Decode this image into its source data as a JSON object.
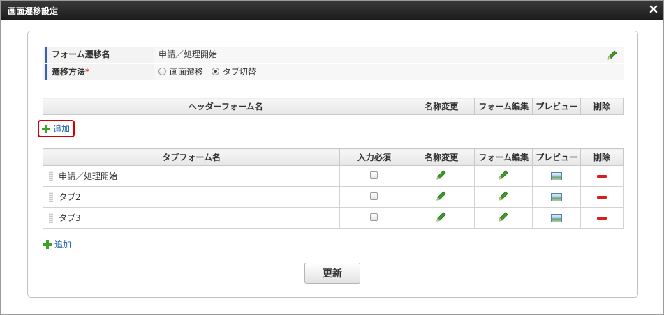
{
  "dialog": {
    "title": "画面遷移設定"
  },
  "form_name": {
    "label": "フォーム遷移名",
    "value": "申請／処理開始"
  },
  "transition_method": {
    "label": "遷移方法",
    "required_mark": "*",
    "options": [
      {
        "label": "画面遷移",
        "selected": false
      },
      {
        "label": "タブ切替",
        "selected": true
      }
    ]
  },
  "header_table": {
    "columns": [
      "ヘッダーフォーム名",
      "名称変更",
      "フォーム編集",
      "プレビュー",
      "削除"
    ],
    "add_label": "追加"
  },
  "tab_table": {
    "columns": [
      "タブフォーム名",
      "入力必須",
      "名称変更",
      "フォーム編集",
      "プレビュー",
      "削除"
    ],
    "rows": [
      {
        "name": "申請／処理開始",
        "required": false
      },
      {
        "name": "タブ2",
        "required": false
      },
      {
        "name": "タブ3",
        "required": false
      }
    ],
    "add_label": "追加"
  },
  "update_label": "更新",
  "colors": {
    "accent": "#3b5fb0",
    "highlight": "#d40000",
    "add": "#3ea12a",
    "delete": "#d62020"
  }
}
